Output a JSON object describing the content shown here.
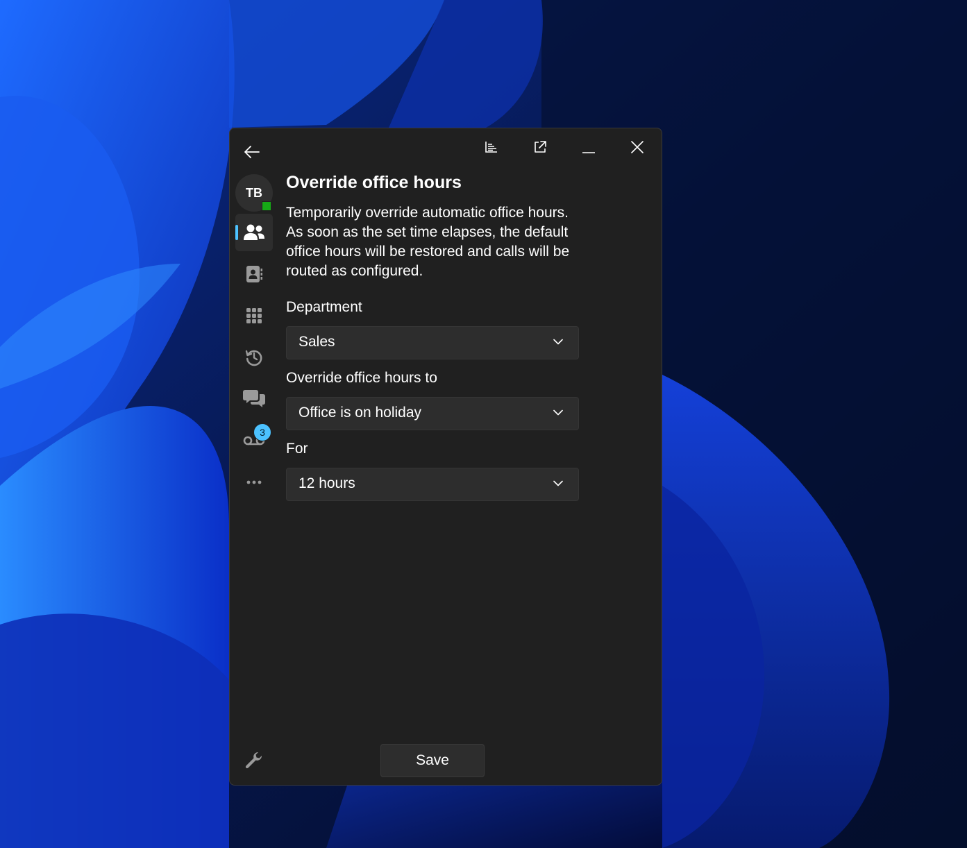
{
  "window": {
    "title": "Override office hours",
    "description": "Temporarily override automatic office hours. As soon as the set time elapses, the default office hours will be restored and calls will be routed as configured."
  },
  "titlebar": {
    "buttons": [
      "chart-icon",
      "open-external-icon",
      "minimize-icon",
      "close-icon"
    ]
  },
  "user": {
    "initials": "TB",
    "presence_color": "#16a816"
  },
  "rail": {
    "items": [
      {
        "name": "people-icon",
        "active": true
      },
      {
        "name": "contact-card-icon",
        "active": false
      },
      {
        "name": "dialpad-icon",
        "active": false
      },
      {
        "name": "history-icon",
        "active": false
      },
      {
        "name": "chat-icon",
        "active": false
      },
      {
        "name": "voicemail-icon",
        "active": false,
        "badge": "3"
      },
      {
        "name": "more-icon",
        "active": false
      }
    ],
    "settings_icon": "wrench-icon",
    "accent": "#4cc2ff"
  },
  "form": {
    "department": {
      "label": "Department",
      "value": "Sales"
    },
    "override_to": {
      "label": "Override office hours to",
      "value": "Office is on holiday"
    },
    "duration": {
      "label": "For",
      "value": "12 hours"
    }
  },
  "actions": {
    "save_label": "Save"
  }
}
